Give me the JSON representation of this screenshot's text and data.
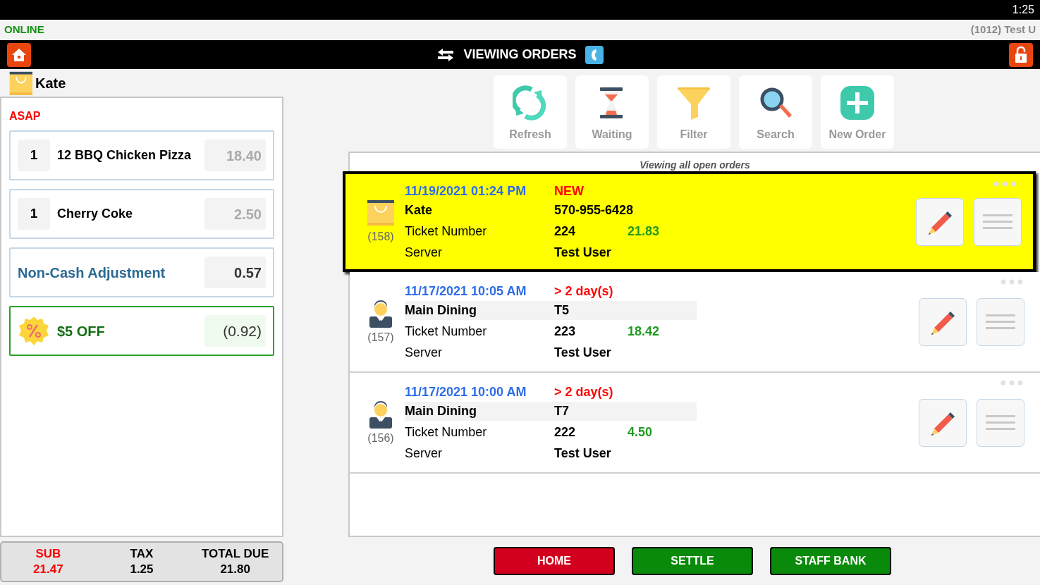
{
  "status_bar": {
    "time": "1:25"
  },
  "connection": {
    "label": "ONLINE",
    "user": "(1012) Test U"
  },
  "header": {
    "title": "VIEWING ORDERS"
  },
  "customer": {
    "name": "Kate"
  },
  "ticket": {
    "timing": "ASAP",
    "lines": [
      {
        "kind": "item",
        "qty": "1",
        "name": "12 BBQ Chicken Pizza",
        "amount": "18.40"
      },
      {
        "kind": "item",
        "qty": "1",
        "name": "Cherry Coke",
        "amount": "2.50"
      },
      {
        "kind": "adjustment",
        "name": "Non-Cash Adjustment",
        "amount": "0.57"
      },
      {
        "kind": "discount",
        "name": "$5 OFF",
        "amount": "(0.92)"
      }
    ]
  },
  "totals": [
    {
      "label": "SUB",
      "value": "21.47",
      "kind": "sub"
    },
    {
      "label": "TAX",
      "value": "1.25",
      "kind": "plain"
    },
    {
      "label": "TOTAL DUE",
      "value": "21.80",
      "kind": "plain"
    }
  ],
  "toolbar": [
    {
      "label": "Refresh",
      "kind": "refresh"
    },
    {
      "label": "Waiting",
      "kind": "waiting"
    },
    {
      "label": "Filter",
      "kind": "filter"
    },
    {
      "label": "Search",
      "kind": "search"
    },
    {
      "label": "New Order",
      "kind": "new"
    }
  ],
  "orders_caption": "Viewing all open orders",
  "orders": [
    {
      "selected": true,
      "kind": "takeout",
      "number": "(158)",
      "date": "11/19/2021 01:24 PM",
      "age": "NEW",
      "line2_label": "Kate",
      "line2_value": "570-955-6428",
      "ticket_label": "Ticket Number",
      "ticket": "224",
      "total": "21.83",
      "server_label": "Server",
      "server": "Test User"
    },
    {
      "selected": false,
      "kind": "dinein",
      "number": "(157)",
      "date": "11/17/2021 10:05 AM",
      "age": "> 2 day(s)",
      "line2_label": "Main Dining",
      "line2_value": "T5",
      "ticket_label": "Ticket Number",
      "ticket": "223",
      "total": "18.42",
      "server_label": "Server",
      "server": "Test User"
    },
    {
      "selected": false,
      "kind": "dinein",
      "number": "(156)",
      "date": "11/17/2021 10:00 AM",
      "age": "> 2 day(s)",
      "line2_label": "Main Dining",
      "line2_value": "T7",
      "ticket_label": "Ticket Number",
      "ticket": "222",
      "total": "4.50",
      "server_label": "Server",
      "server": "Test User"
    }
  ],
  "bottom_buttons": [
    {
      "label": "HOME",
      "kind": "home"
    },
    {
      "label": "SETTLE",
      "kind": "settle"
    },
    {
      "label": "STAFF BANK",
      "kind": "bank"
    }
  ]
}
